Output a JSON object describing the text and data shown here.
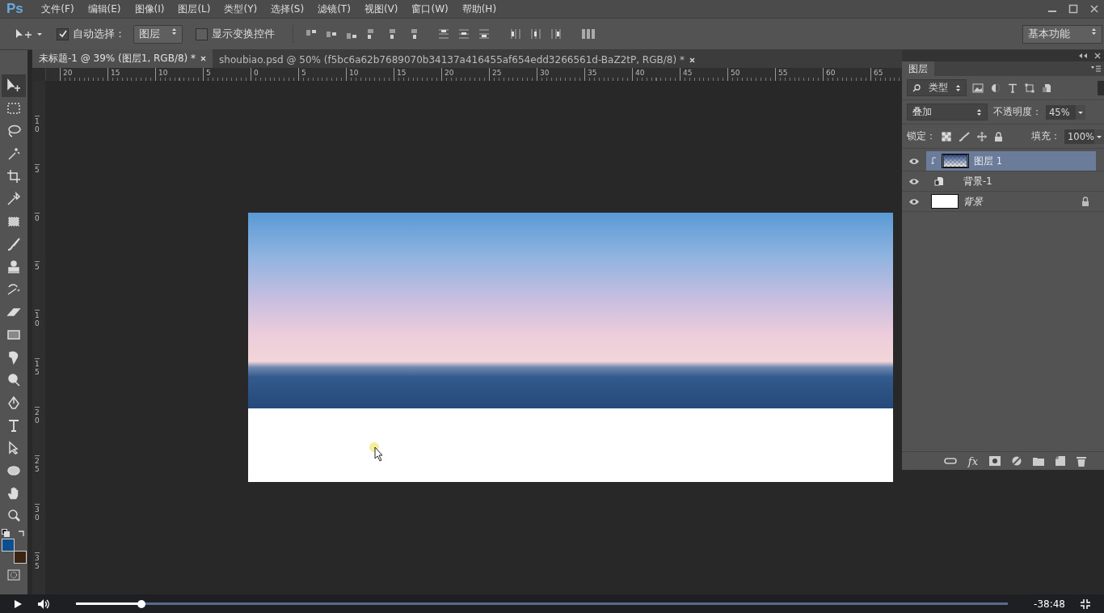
{
  "menu_bar": {
    "logo": "Ps",
    "items": [
      "文件(F)",
      "编辑(E)",
      "图像(I)",
      "图层(L)",
      "类型(Y)",
      "选择(S)",
      "滤镜(T)",
      "视图(V)",
      "窗口(W)",
      "帮助(H)"
    ]
  },
  "options_bar": {
    "auto_select": {
      "label": "自动选择：",
      "checked": true
    },
    "auto_select_target": "图层",
    "show_transform": {
      "label": "显示变换控件",
      "checked": false
    },
    "workspace": "基本功能"
  },
  "toolbar": {
    "tools": [
      {
        "kind": "move",
        "selected": true
      },
      {
        "kind": "marquee",
        "selected": false
      },
      {
        "kind": "lasso",
        "selected": false
      },
      {
        "kind": "wand",
        "selected": false
      },
      {
        "kind": "crop",
        "selected": false
      },
      {
        "kind": "eyedropper",
        "selected": false
      },
      {
        "kind": "patch",
        "selected": false
      },
      {
        "kind": "brush",
        "selected": false
      },
      {
        "kind": "stamp",
        "selected": false
      },
      {
        "kind": "history",
        "selected": false
      },
      {
        "kind": "eraser",
        "selected": false
      },
      {
        "kind": "gradient",
        "selected": false
      },
      {
        "kind": "smudge",
        "selected": false
      },
      {
        "kind": "dodge",
        "selected": false
      },
      {
        "kind": "pen",
        "selected": false
      },
      {
        "kind": "type",
        "selected": false
      },
      {
        "kind": "select",
        "selected": false
      },
      {
        "kind": "ellipse",
        "selected": false
      },
      {
        "kind": "hand",
        "selected": false
      },
      {
        "kind": "zoom",
        "selected": false
      }
    ],
    "swatches": [
      {
        "kind": "foreground",
        "color": "#0c4e8e"
      },
      {
        "kind": "background",
        "color": "#3b2412"
      }
    ]
  },
  "tabs": [
    {
      "label": "未标题-1 @ 39% (图层1, RGB/8) *",
      "selected": true
    },
    {
      "label": "shoubiao.psd @ 50% (f5bc6a62b7689070b34137a416455af654edd3266561d-BaZ2tP, RGB/8) *",
      "selected": false
    }
  ],
  "rulers": {
    "horizontal": [
      "20",
      "15",
      "10",
      "5",
      "0",
      "5",
      "10",
      "15",
      "20",
      "25",
      "30",
      "35",
      "40",
      "45",
      "50",
      "55",
      "60",
      "65"
    ],
    "vertical": [
      "10",
      "5",
      "0",
      "5",
      "10",
      "15",
      "20",
      "25",
      "30",
      "35"
    ]
  },
  "layers_panel": {
    "title": "图层",
    "filter": "类型",
    "blend_mode": "叠加",
    "opacity_label": "不透明度：",
    "opacity": "45%",
    "lock_label": "锁定：",
    "fill_label": "填充：",
    "fill": "100%",
    "fx": "fx",
    "layers": [
      {
        "name": "图层 1",
        "kind": "pixel",
        "selected": true,
        "visible": true,
        "clipped": true,
        "locked": false
      },
      {
        "name": "背景-1",
        "kind": "smart",
        "selected": false,
        "visible": true,
        "clipped": false,
        "locked": false
      },
      {
        "name": "背景",
        "kind": "background",
        "selected": false,
        "visible": true,
        "clipped": false,
        "locked": true
      }
    ]
  },
  "video_player": {
    "progress": {
      "level": 0.07
    },
    "time": "-38:48"
  }
}
